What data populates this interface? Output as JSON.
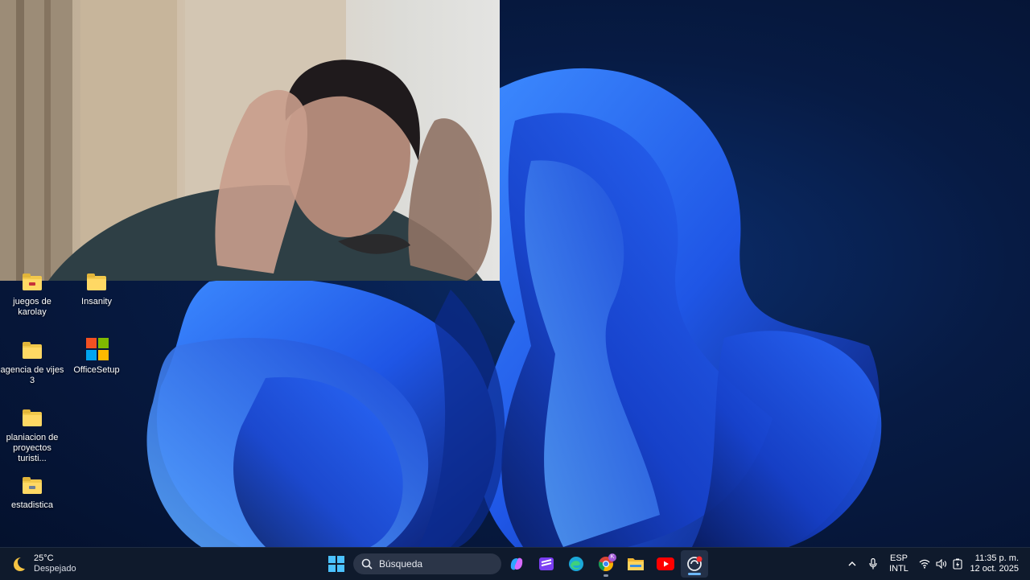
{
  "desktop": {
    "icons": [
      {
        "label": "juegos de karolay",
        "icon": "folder-icon"
      },
      {
        "label": "Insanity",
        "icon": "folder-icon"
      },
      {
        "label": "agencia de vijes 3",
        "icon": "folder-icon"
      },
      {
        "label": "OfficeSetup",
        "icon": "office-setup-icon"
      },
      {
        "label": "planiacion de proyectos turisti...",
        "icon": "folder-icon"
      },
      {
        "label": "estadistica",
        "icon": "folder-icon"
      }
    ]
  },
  "webcam": {
    "description_icon": "webcam-overlay"
  },
  "taskbar": {
    "weather": {
      "temperature": "25°C",
      "condition": "Despejado",
      "icon": "moon-icon"
    },
    "search": {
      "placeholder": "Búsqueda"
    },
    "apps": [
      {
        "name": "start",
        "icon": "windows-start-icon"
      },
      {
        "name": "copilot",
        "icon": "copilot-icon"
      },
      {
        "name": "clipchamp",
        "icon": "clipchamp-icon"
      },
      {
        "name": "edge",
        "icon": "edge-icon"
      },
      {
        "name": "chrome",
        "icon": "chrome-icon",
        "badge": "K"
      },
      {
        "name": "file-explorer",
        "icon": "folder-icon"
      },
      {
        "name": "youtube",
        "icon": "youtube-icon"
      },
      {
        "name": "recorder",
        "icon": "recorder-icon"
      }
    ],
    "tray": {
      "language_primary": "ESP",
      "language_secondary": "INTL",
      "time": "11:35 p. m.",
      "date": "12 oct. 2025"
    }
  },
  "colors": {
    "taskbar_bg": "#0f1a2c",
    "wallpaper_bloom": "#1f56e6",
    "accent": "#6cb8ff"
  }
}
